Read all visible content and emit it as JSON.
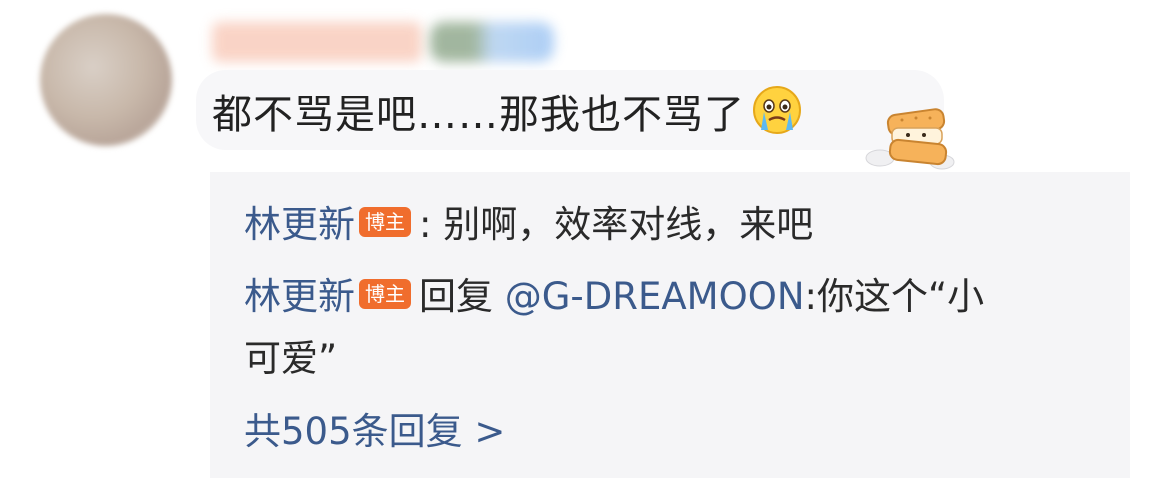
{
  "comment": {
    "text": "都不骂是吧……那我也不骂了",
    "emoji_icon": "crying-face-icon",
    "sticker_icon": "sandwich-cookie-dog-sticker"
  },
  "replies": [
    {
      "name": "林更新",
      "tag": "博主",
      "text": ": 别啊，效率对线，来吧"
    },
    {
      "name": "林更新",
      "tag": "博主",
      "prefix": "回复 ",
      "mention": "@G-DREAMOON",
      "text_line1": ":你这个“小",
      "text_line2": "可爱”"
    }
  ],
  "more_replies": "共505条回复 >",
  "colors": {
    "link": "#3b5a8c",
    "tag_bg": "#f06d2d",
    "panel_bg": "#f5f5f7"
  }
}
